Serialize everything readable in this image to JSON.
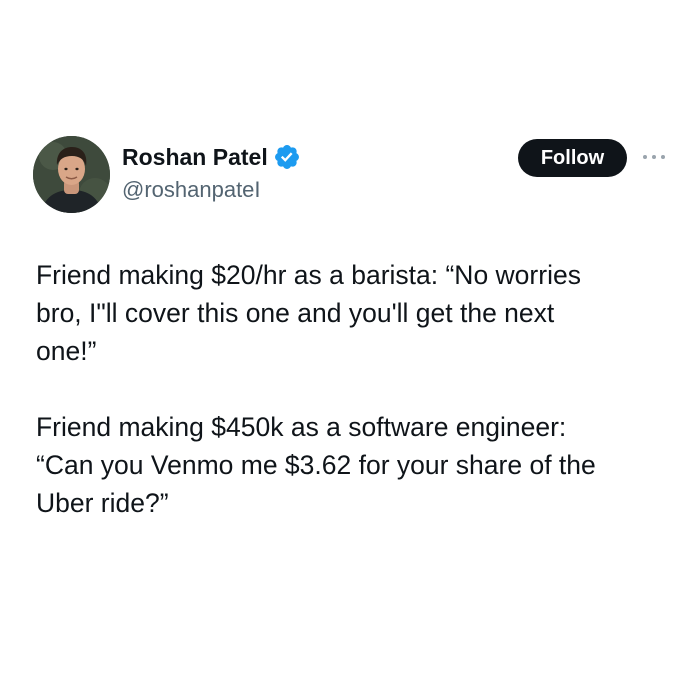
{
  "author": {
    "display_name": "Roshan Patel",
    "handle": "@roshanpateI",
    "verified": true,
    "verified_badge_color": "#1d9bf0"
  },
  "actions": {
    "follow_label": "Follow",
    "more_icon": "more-options-icon"
  },
  "tweet": {
    "paragraphs": [
      "Friend making $20/hr as a barista: “No worries\nbro, I\"ll cover this one and you'll get the next\none!”",
      "Friend making $450k as a software engineer:\n“Can you Venmo me $3.62 for your share of the\nUber ride?”"
    ]
  },
  "colors": {
    "text": "#0f1419",
    "secondary_text": "#536471",
    "button_bg": "#0f1419",
    "button_text": "#ffffff"
  }
}
